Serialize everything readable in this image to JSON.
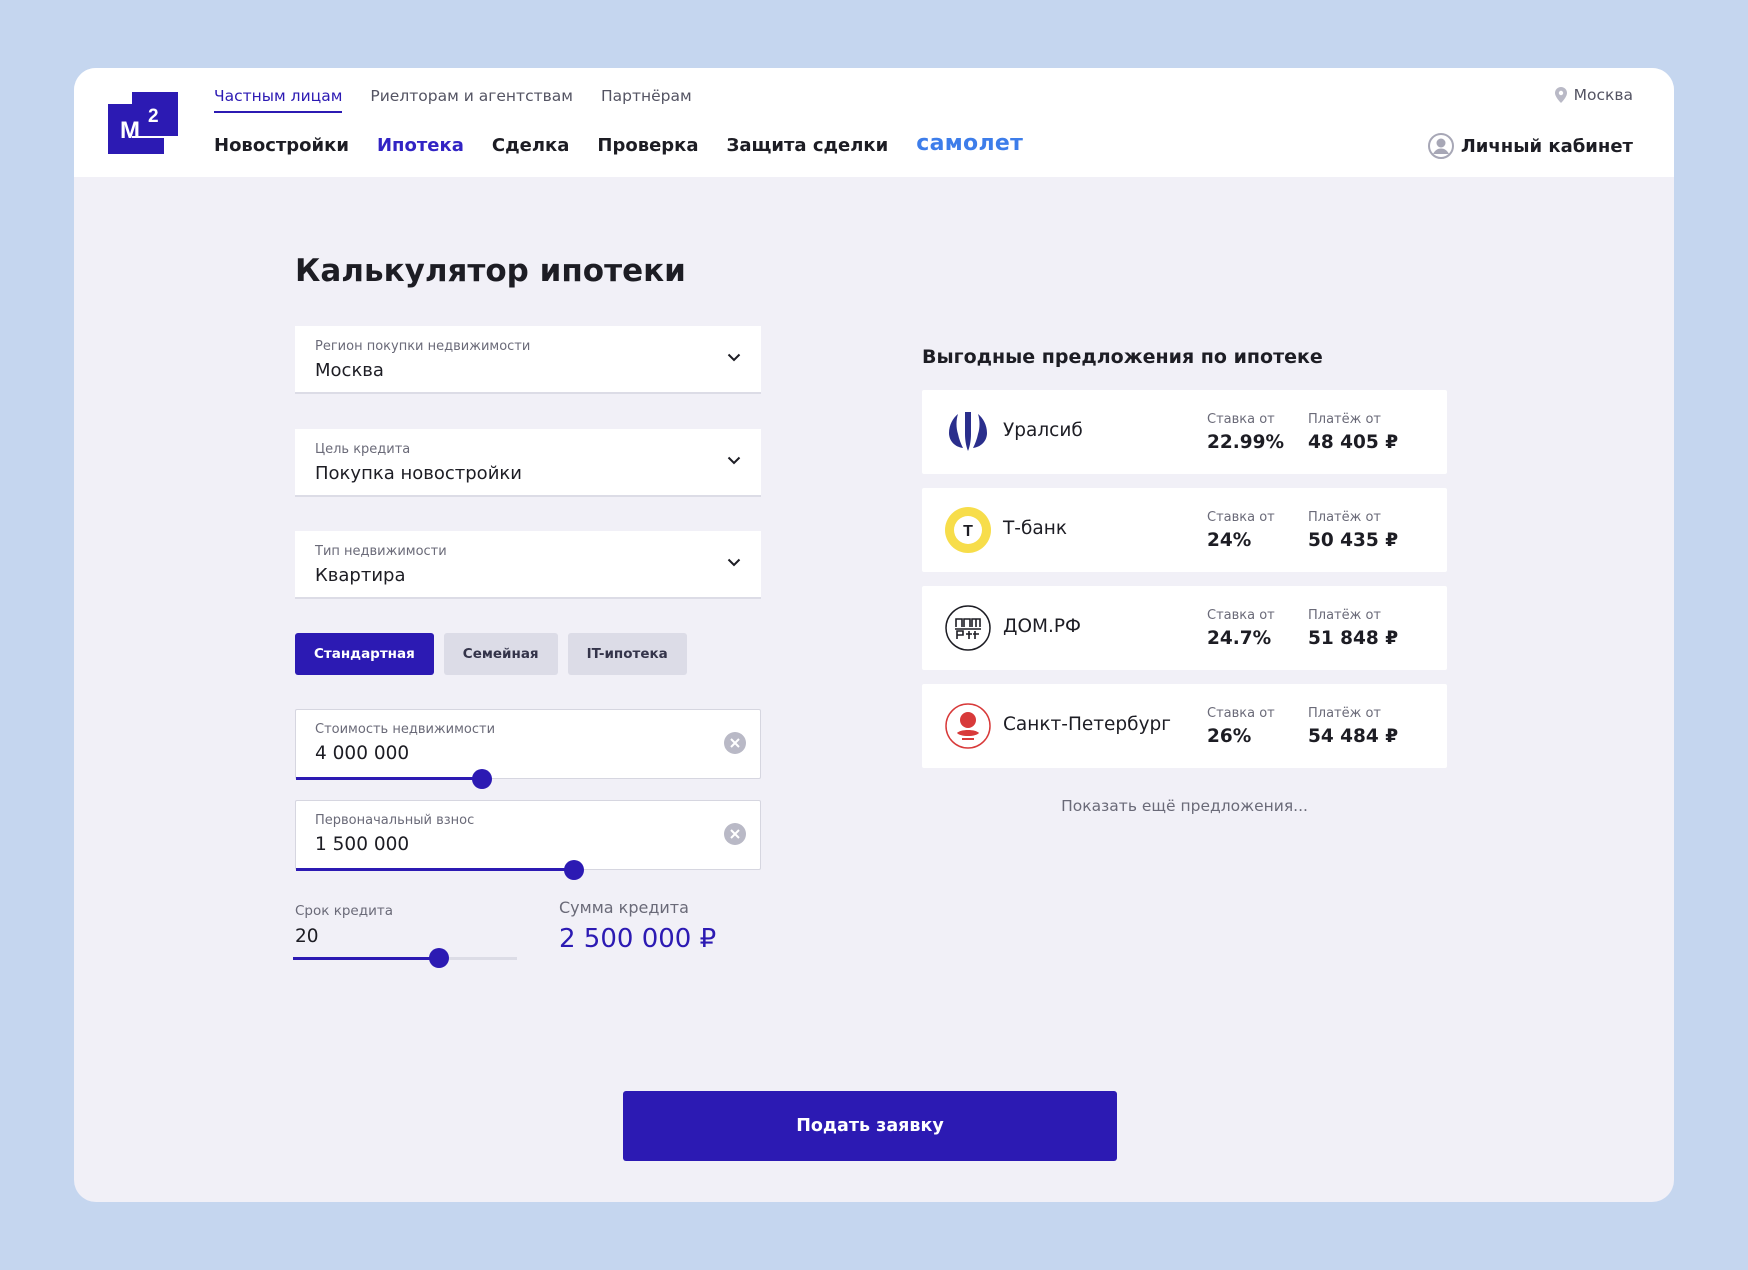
{
  "header": {
    "logo_text": "М",
    "logo_sup": "2",
    "top_links": [
      "Частным лицам",
      "Риелторам и агентствам",
      "Партнёрам"
    ],
    "nav": [
      "Новостройки",
      "Ипотека",
      "Сделка",
      "Проверка",
      "Защита сделки"
    ],
    "nav_brand": "самолет",
    "city": "Москва",
    "cabinet": "Личный кабинет"
  },
  "calc": {
    "title": "Калькулятор ипотеки",
    "region": {
      "label": "Регион покупки недвижимости",
      "value": "Москва"
    },
    "purpose": {
      "label": "Цель кредита",
      "value": "Покупка новостройки"
    },
    "type": {
      "label": "Тип недвижимости",
      "value": "Квартира"
    },
    "tabs": [
      "Стандартная",
      "Семейная",
      "IT-ипотека"
    ],
    "price": {
      "label": "Стоимость недвижимости",
      "value": "4 000 000",
      "level": 0.4
    },
    "down": {
      "label": "Первоначальный взнос",
      "value": "1 500 000",
      "level": 0.6
    },
    "term": {
      "label": "Срок кредита",
      "value": "20",
      "level": 0.65
    },
    "sum": {
      "label": "Сумма кредита",
      "value": "2 500 000 ₽"
    }
  },
  "offers": {
    "title": "Выгодные предложения по ипотеке",
    "rate_label": "Ставка от",
    "payment_label": "Платёж от",
    "items": [
      {
        "bank": "Уралсиб",
        "rate": "22.99%",
        "payment": "48 405 ₽"
      },
      {
        "bank": "Т-банк",
        "rate": "24%",
        "payment": "50 435 ₽",
        "logo_letter": "Т"
      },
      {
        "bank": "ДОМ.РФ",
        "rate": "24.7%",
        "payment": "51 848 ₽"
      },
      {
        "bank": "Санкт-Петербург",
        "rate": "26%",
        "payment": "54 484 ₽"
      }
    ],
    "more": "Показать ещё предложения..."
  },
  "submit": "Подать заявку",
  "colors": {
    "accent": "#2c1ab3",
    "brand": "#3d7dea",
    "background": "#c5d6ef",
    "card": "#f1f0f7"
  }
}
